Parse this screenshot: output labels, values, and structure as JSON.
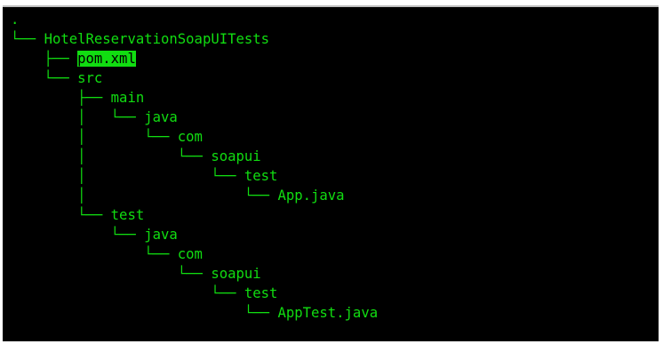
{
  "terminal": {
    "text_color": "#11dd11",
    "background_color": "#000000",
    "lines": [
      {
        "prefix": ".",
        "name": ""
      },
      {
        "prefix": "└── ",
        "name": "HotelReservationSoapUITests"
      },
      {
        "prefix": "    ├── ",
        "name": "pom.xml",
        "highlighted": true
      },
      {
        "prefix": "    └── ",
        "name": "src"
      },
      {
        "prefix": "        ├── ",
        "name": "main"
      },
      {
        "prefix": "        │   └── ",
        "name": "java"
      },
      {
        "prefix": "        │       └── ",
        "name": "com"
      },
      {
        "prefix": "        │           └── ",
        "name": "soapui"
      },
      {
        "prefix": "        │               └── ",
        "name": "test"
      },
      {
        "prefix": "        │                   └── ",
        "name": "App.java"
      },
      {
        "prefix": "        └── ",
        "name": "test"
      },
      {
        "prefix": "            └── ",
        "name": "java"
      },
      {
        "prefix": "                └── ",
        "name": "com"
      },
      {
        "prefix": "                    └── ",
        "name": "soapui"
      },
      {
        "prefix": "                        └── ",
        "name": "test"
      },
      {
        "prefix": "                            └── ",
        "name": "AppTest.java"
      }
    ]
  }
}
